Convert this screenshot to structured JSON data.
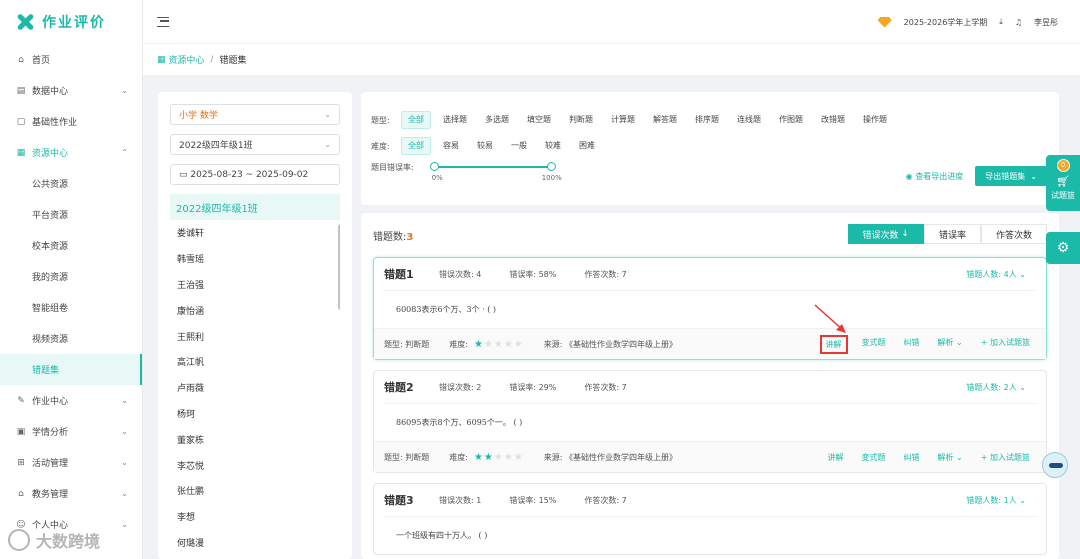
{
  "app": {
    "title": "作业评价"
  },
  "sidebar": {
    "items": [
      {
        "label": "首页",
        "icon": "home-icon"
      },
      {
        "label": "数据中心",
        "icon": "chart-icon"
      },
      {
        "label": "基础性作业",
        "icon": "doc-icon"
      },
      {
        "label": "资源中心",
        "icon": "grid-icon"
      },
      {
        "label": "作业中心",
        "icon": "edit-icon"
      },
      {
        "label": "学情分析",
        "icon": "analysis-icon"
      },
      {
        "label": "活动管理",
        "icon": "gift-icon"
      },
      {
        "label": "教务管理",
        "icon": "building-icon"
      },
      {
        "label": "个人中心",
        "icon": "user-icon"
      }
    ],
    "resource_subitems": [
      "公共资源",
      "平台资源",
      "校本资源",
      "我的资源",
      "智能组卷",
      "视频资源",
      "错题集"
    ]
  },
  "topbar": {
    "semester": "2025-2026学年上学期",
    "user": "李昱彤"
  },
  "breadcrumb": {
    "parent": "资源中心",
    "separator": "/",
    "current": "错题集"
  },
  "classpanel": {
    "subject": "小学 数学",
    "class_select": "2022级四年级1班",
    "date_range": "2025-08-23 ~ 2025-09-02",
    "class_header": "2022级四年级1班",
    "students": [
      "娄诚轩",
      "韩雪瑶",
      "王治强",
      "康怡涵",
      "王熙利",
      "高江帆",
      "卢雨薇",
      "杨珂",
      "董家栋",
      "李芯悦",
      "张仕鹏",
      "李想",
      "何璐漫"
    ]
  },
  "filters": {
    "type_label": "题型:",
    "types": [
      "全部",
      "选择题",
      "多选题",
      "填空题",
      "判断题",
      "计算题",
      "解答题",
      "排序题",
      "连线题",
      "作图题",
      "改错题",
      "操作题"
    ],
    "difficulty_label": "难度:",
    "difficulties": [
      "全部",
      "容易",
      "较易",
      "一般",
      "较难",
      "困难"
    ],
    "error_rate_label": "题目错误率:",
    "rate_min": "0%",
    "rate_max": "100%",
    "progress_link": "查看导出进度",
    "export_button": "导出错题集"
  },
  "questions_panel": {
    "count_label": "错题数:",
    "count": "3",
    "sort_buttons": [
      "错误次数",
      "错误率",
      "作答次数"
    ]
  },
  "questions": [
    {
      "title": "错题1",
      "errors": "错误次数: 4",
      "rate": "错误率: 58%",
      "answers": "作答次数: 7",
      "people": "错题人数: 4人",
      "content": "60083表示6个万、3个 ·                              (      )",
      "qtype": "题型: 判断题",
      "difficulty_label": "难度:",
      "stars": 1,
      "source": "来源: 《基础性作业数学四年级上册》"
    },
    {
      "title": "错题2",
      "errors": "错误次数: 2",
      "rate": "错误率: 29%",
      "answers": "作答次数: 7",
      "people": "错题人数: 2人",
      "content": "86095表示8个万、6095个一。                        (      )",
      "qtype": "题型: 判断题",
      "difficulty_label": "难度:",
      "stars": 2,
      "source": "来源: 《基础性作业数学四年级上册》"
    },
    {
      "title": "错题3",
      "errors": "错误次数: 1",
      "rate": "错误率: 15%",
      "answers": "作答次数: 7",
      "people": "错题人数: 1人",
      "content": "一个班级有四十万人。                    (      )"
    }
  ],
  "card_actions": [
    "讲解",
    "变式题",
    "纠错",
    "解析",
    "+ 加入试题篮"
  ],
  "float": {
    "cart_badge": "0",
    "cart_label": "试题篮"
  },
  "watermark": "大数跨境",
  "colors": {
    "accent": "#1bb9a8",
    "orange": "#e8721c",
    "highlight": "#e53935"
  }
}
